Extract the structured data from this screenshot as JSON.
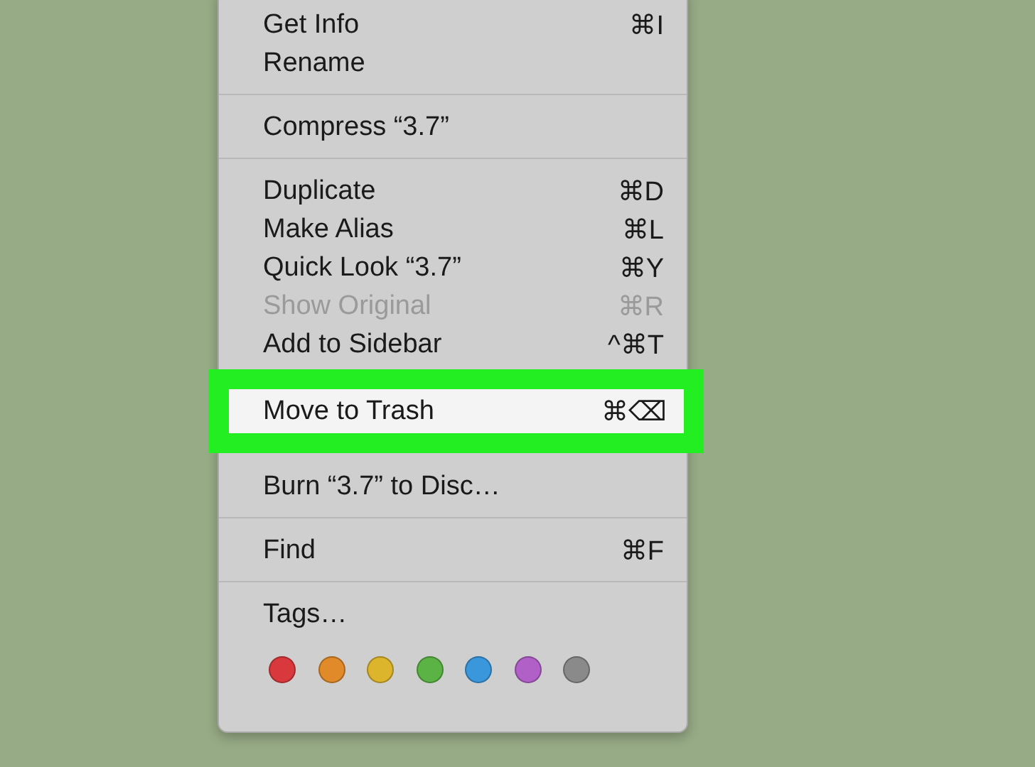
{
  "menu": {
    "sections": [
      {
        "items": [
          {
            "label": "Get Info",
            "shortcut": "⌘I",
            "disabled": false,
            "selected": false
          },
          {
            "label": "Rename",
            "disabled": false,
            "selected": false
          }
        ]
      },
      {
        "items": [
          {
            "label": "Compress “3.7”",
            "disabled": false,
            "selected": false
          }
        ]
      },
      {
        "items": [
          {
            "label": "Duplicate",
            "shortcut": "⌘D",
            "disabled": false,
            "selected": false
          },
          {
            "label": "Make Alias",
            "shortcut": "⌘L",
            "disabled": false,
            "selected": false
          },
          {
            "label": "Quick Look “3.7”",
            "shortcut": "⌘Y",
            "disabled": false,
            "selected": false
          },
          {
            "label": "Show Original",
            "shortcut": "⌘R",
            "disabled": true,
            "selected": false
          },
          {
            "label": "Add to Sidebar",
            "shortcut": "^⌘T",
            "disabled": false,
            "selected": false
          }
        ]
      },
      {
        "items": [
          {
            "label": "Move to Trash",
            "shortcut": "⌘⌫",
            "disabled": false,
            "selected": true
          },
          {
            "label": "Burn “3.7” to Disc…",
            "disabled": false,
            "selected": false
          }
        ]
      },
      {
        "items": [
          {
            "label": "Find",
            "shortcut": "⌘F",
            "disabled": false,
            "selected": false
          }
        ]
      }
    ],
    "tags": {
      "label": "Tags…",
      "colors": [
        {
          "color": "#d9393c"
        },
        {
          "color": "#e08a2a"
        },
        {
          "color": "#dcb52c"
        },
        {
          "color": "#5cb345"
        },
        {
          "color": "#3b97db"
        },
        {
          "color": "#b160c8"
        },
        {
          "color": "#8a8a8a"
        }
      ]
    }
  }
}
